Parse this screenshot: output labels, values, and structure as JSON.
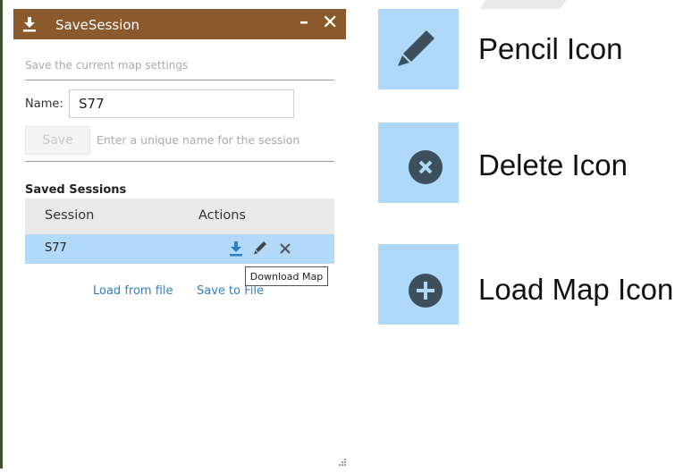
{
  "widget": {
    "title": "SaveSession",
    "minimize_label": "–",
    "close_label": "✕",
    "description": "Save the current map settings",
    "name_label": "Name:",
    "name_value": "S77",
    "save_label": "Save",
    "hint": "Enter a unique name for the session",
    "saved_sessions_title": "Saved Sessions",
    "table": {
      "headers": [
        "Session",
        "Actions"
      ],
      "rows": [
        {
          "session": "S77"
        }
      ]
    },
    "tooltip": "Download Map",
    "load_from_file": "Load from file",
    "save_to_file": "Save to File"
  },
  "legend": [
    {
      "label": "Pencil Icon",
      "icon": "pencil-icon"
    },
    {
      "label": "Delete Icon",
      "icon": "delete-icon"
    },
    {
      "label": "Load Map Icon",
      "icon": "load-map-icon"
    }
  ],
  "colors": {
    "titlebar": "#8a5a2d",
    "selected_row": "#b2d9f7",
    "action_blue": "#2f7fc9",
    "tile": "#add8f7",
    "tile_icon": "#3d4f5c"
  }
}
